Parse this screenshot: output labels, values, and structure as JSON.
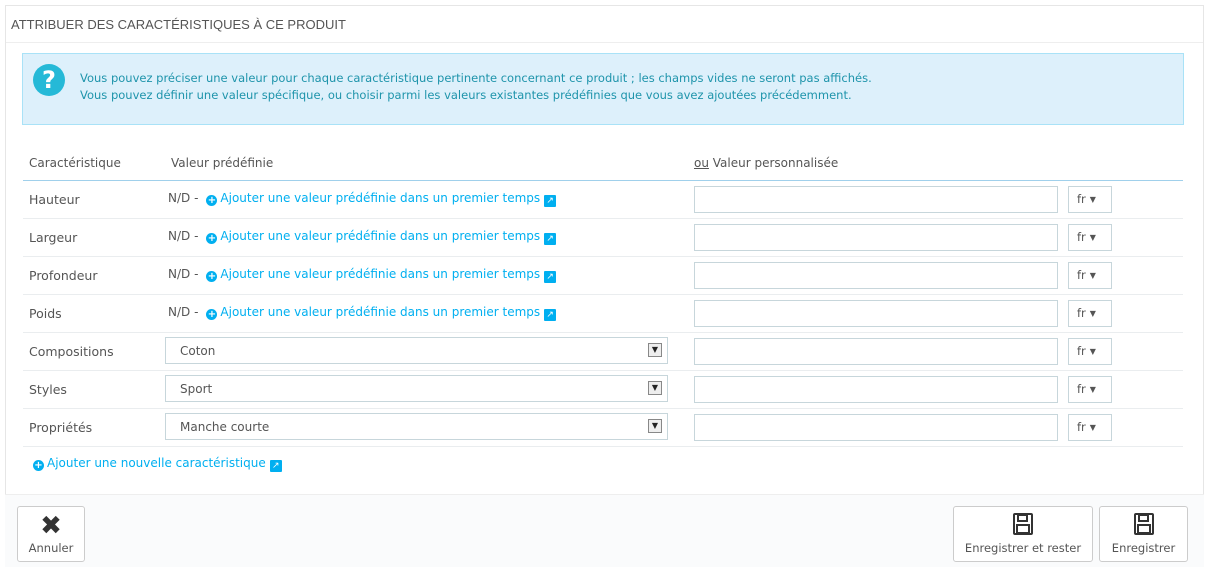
{
  "panel": {
    "heading": "ATTRIBUER DES CARACTÉRISTIQUES À CE PRODUIT"
  },
  "alert": {
    "icon": "question-circle-icon",
    "line1": "Vous pouvez préciser une valeur pour chaque caractéristique pertinente concernant ce produit ; les champs vides ne seront pas affichés.",
    "line2": "Vous pouvez définir une valeur spécifique, ou choisir parmi les valeurs existantes prédéfinies que vous avez ajoutées précédemment."
  },
  "table": {
    "headers": {
      "feature": "Caractéristique",
      "predefined": "Valeur prédéfinie",
      "custom_prefix": "ou",
      "custom": " Valeur personnalisée"
    },
    "nd_label": "N/D -",
    "add_predefined_link": "Ajouter une valeur prédéfinie dans un premier temps",
    "rows": [
      {
        "label": "Hauteur",
        "type": "link",
        "custom_value": "",
        "lang": "fr"
      },
      {
        "label": "Largeur",
        "type": "link",
        "custom_value": "",
        "lang": "fr"
      },
      {
        "label": "Profondeur",
        "type": "link",
        "custom_value": "",
        "lang": "fr"
      },
      {
        "label": "Poids",
        "type": "link",
        "custom_value": "",
        "lang": "fr"
      },
      {
        "label": "Compositions",
        "type": "select",
        "selected": "Coton",
        "custom_value": "",
        "lang": "fr"
      },
      {
        "label": "Styles",
        "type": "select",
        "selected": "Sport",
        "custom_value": "",
        "lang": "fr"
      },
      {
        "label": "Propriétés",
        "type": "select",
        "selected": "Manche courte",
        "custom_value": "",
        "lang": "fr"
      }
    ]
  },
  "add_feature_link": "Ajouter une nouvelle caractéristique",
  "footer": {
    "cancel_label": "Annuler",
    "save_stay_label": "Enregistrer et rester",
    "save_label": "Enregistrer"
  },
  "colors": {
    "accent": "#00aff0",
    "alert_bg": "#ddf0fb",
    "alert_text": "#1e94ab"
  }
}
